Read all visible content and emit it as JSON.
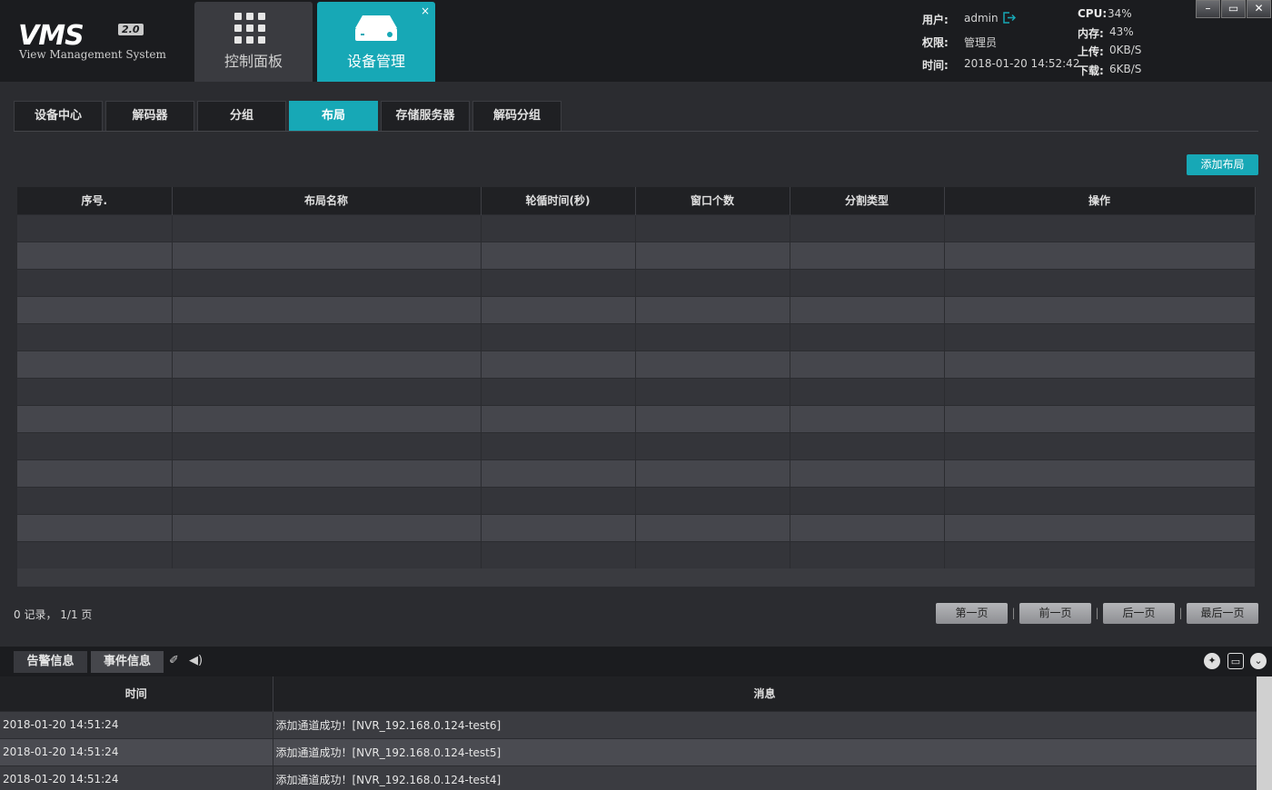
{
  "app": {
    "logo_text": "VMS",
    "logo_version": "2.0",
    "logo_subtitle": "View Management System"
  },
  "main_tabs": [
    {
      "label": "控制面板"
    },
    {
      "label": "设备管理",
      "close": "×"
    }
  ],
  "status": {
    "user_label": "用户:",
    "user_value": "admin",
    "role_label": "权限:",
    "role_value": "管理员",
    "time_label": "时间:",
    "time_value": "2018-01-20 14:52:42",
    "cpu_label": "CPU:",
    "cpu_value": "34%",
    "mem_label": "内存:",
    "mem_value": "43%",
    "up_label": "上传:",
    "up_value": "0KB/S",
    "down_label": "下载:",
    "down_value": "6KB/S"
  },
  "window_controls": {
    "minimize": "–",
    "restore": "▭",
    "close": "✕"
  },
  "sub_tabs": [
    "设备中心",
    "解码器",
    "分组",
    "布局",
    "存储服务器",
    "解码分组"
  ],
  "add_button": "添加布局",
  "table": {
    "columns": [
      "序号.",
      "布局名称",
      "轮循时间(秒)",
      "窗口个数",
      "分割类型",
      "操作"
    ]
  },
  "pagination": {
    "records": "0 记录， 1/1 页",
    "first": "第一页",
    "prev": "前一页",
    "next": "后一页",
    "last": "最后一页"
  },
  "bottom_panel": {
    "tab_alarm": "告警信息",
    "tab_event": "事件信息",
    "columns": [
      "时间",
      "消息"
    ],
    "rows": [
      {
        "time": "2018-01-20 14:51:24",
        "message": "添加通道成功！[NVR_192.168.0.124-test6]"
      },
      {
        "time": "2018-01-20 14:51:24",
        "message": "添加通道成功！[NVR_192.168.0.124-test5]"
      },
      {
        "time": "2018-01-20 14:51:24",
        "message": "添加通道成功！[NVR_192.168.0.124-test4]"
      }
    ]
  },
  "colors": {
    "accent": "#17a8b6",
    "background": "#2b2c30",
    "header": "#1b1c1f"
  }
}
